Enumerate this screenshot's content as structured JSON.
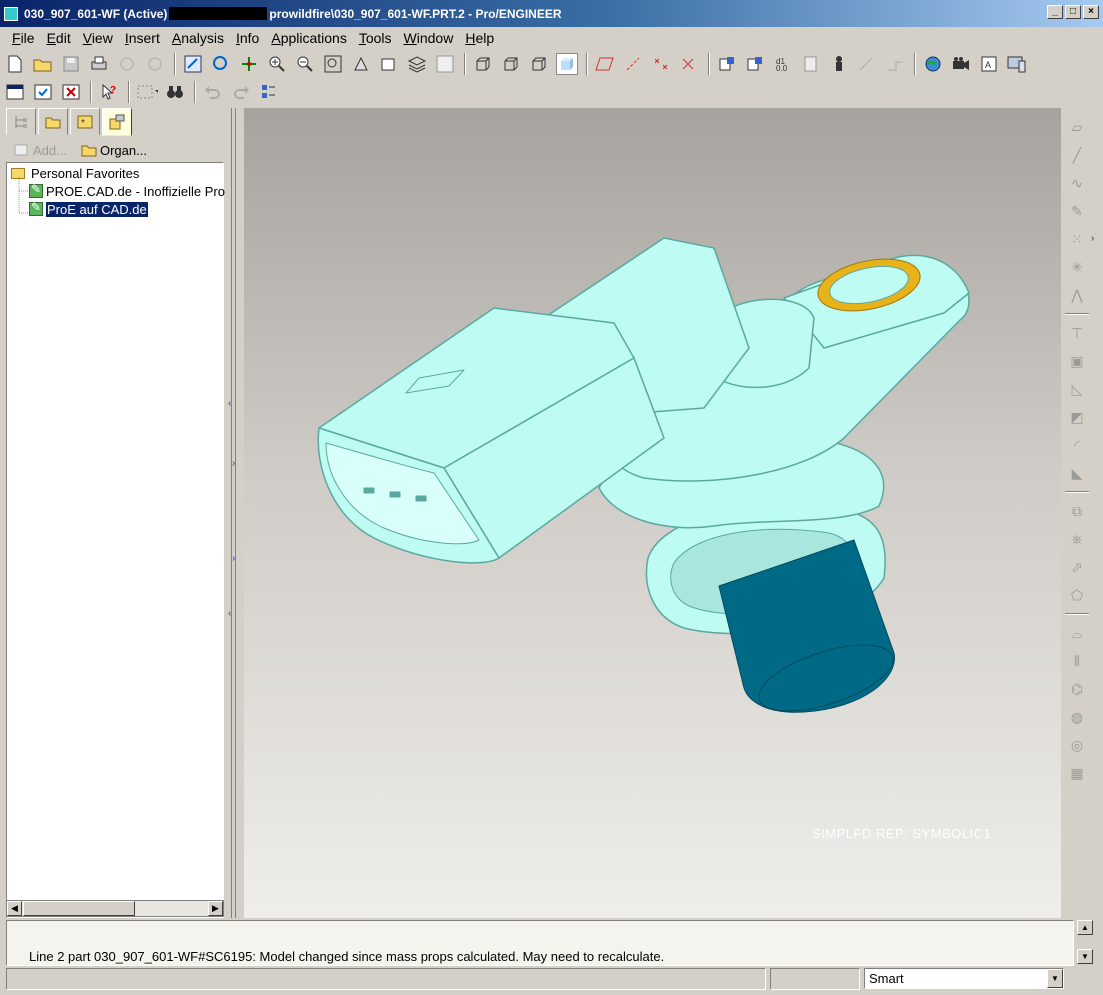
{
  "window": {
    "title_left": "030_907_601-WF (Active)",
    "title_right": "prowildfire\\030_907_601-WF.PRT.2 - Pro/ENGINEER",
    "min": "_",
    "max": "□",
    "close": "×"
  },
  "menu": [
    {
      "u": "F",
      "rest": "ile"
    },
    {
      "u": "E",
      "rest": "dit"
    },
    {
      "u": "V",
      "rest": "iew"
    },
    {
      "u": "I",
      "rest": "nsert"
    },
    {
      "u": "A",
      "rest": "nalysis"
    },
    {
      "u": "I",
      "rest": "nfo"
    },
    {
      "u": "A",
      "rest": "pplications"
    },
    {
      "u": "T",
      "rest": "ools"
    },
    {
      "u": "W",
      "rest": "indow"
    },
    {
      "u": "H",
      "rest": "elp"
    }
  ],
  "navigator": {
    "add_label": "Add...",
    "organize_label": "Organ...",
    "tree": [
      {
        "label": "Personal Favorites",
        "type": "folder"
      },
      {
        "label": "PROE.CAD.de - Inoffizielle Pro",
        "type": "link"
      },
      {
        "label": "ProE auf CAD.de",
        "type": "link",
        "selected": true
      }
    ]
  },
  "viewport": {
    "rep_label": "SIMPLFD REP: SYMBOLIC1",
    "colors": {
      "body": "#bdfbf3",
      "edge": "#5aa99f",
      "cylinder": "#006a86",
      "ring": "#e8b21a"
    }
  },
  "message": "Line 2 part 030_907_601-WF#SC6195: Model changed since mass props calculated. May need to recalculate.",
  "filter": {
    "selected": "Smart"
  }
}
